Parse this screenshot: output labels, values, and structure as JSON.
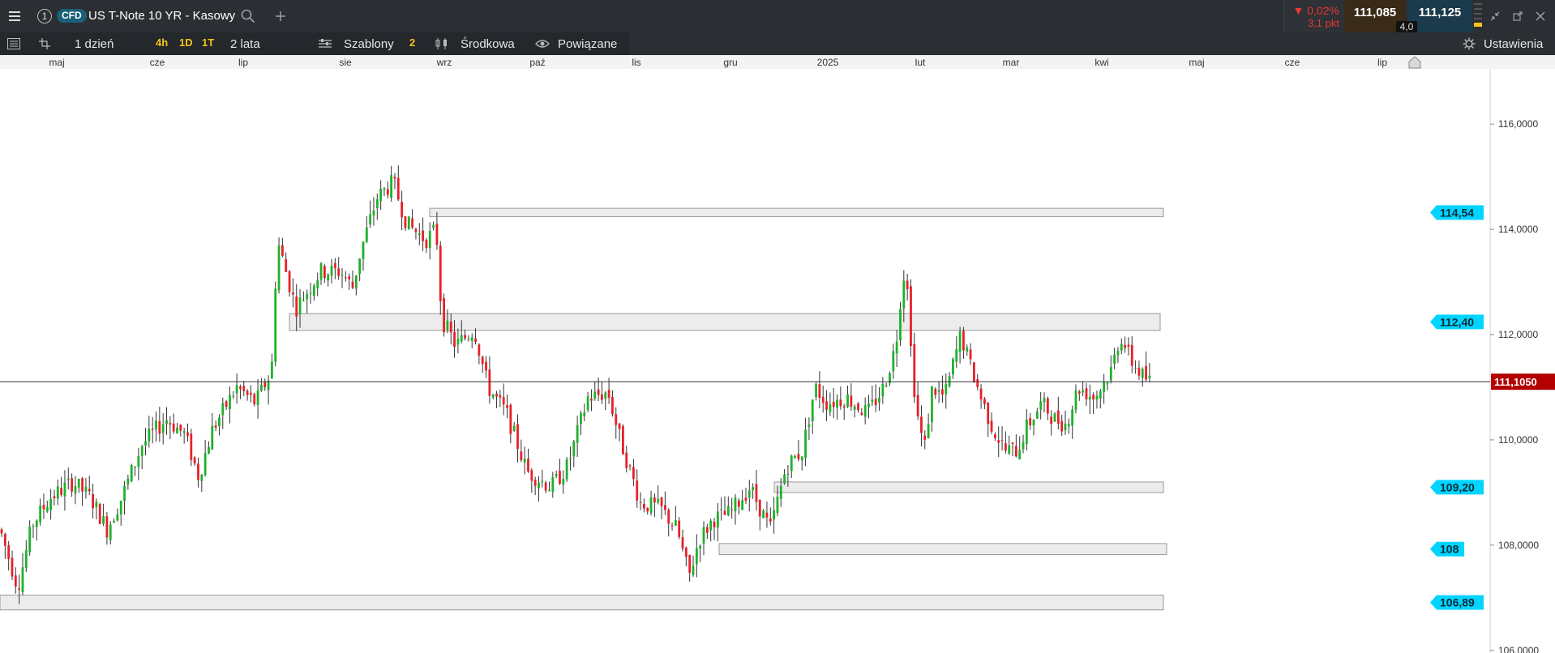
{
  "window": {
    "menu_icon": "hamburger-icon",
    "chart_number": "1",
    "instrument_badge": "CFD",
    "instrument_name": "US T-Note 10 YR - Kasowy",
    "search_icon": "search-icon",
    "add_icon": "plus-icon"
  },
  "quote": {
    "change_pct": "▼ 0,02%",
    "change_pts": "3,1 pkt",
    "sell": "111,085",
    "buy": "111,125",
    "spread": "4,0",
    "down_color": "#e53935",
    "sell_bg": "#3a2a18",
    "buy_bg": "#1b3a4b"
  },
  "window_controls": [
    "minimize-icon",
    "popout-icon",
    "close-icon"
  ],
  "toolbar": {
    "interval": "1 dzień",
    "quick_intervals": [
      "4h",
      "1D",
      "1T"
    ],
    "range": "2 lata",
    "templates": "Szablony",
    "indicator_count": "2",
    "price_type": "Środkowa",
    "linked": "Powiązane",
    "settings": "Ustawienia"
  },
  "chart_data": {
    "type": "candlestick",
    "title": "",
    "x_ticks": [
      "maj",
      "cze",
      "lip",
      "sie",
      "wrz",
      "paź",
      "lis",
      "gru",
      "2025",
      "lut",
      "mar",
      "kwi",
      "maj",
      "cze",
      "lip"
    ],
    "y_ticks": [
      "116,0000",
      "114,0000",
      "112,0000",
      "110,0000",
      "108,0000",
      "106,0000"
    ],
    "ylim": [
      105.95,
      117.05
    ],
    "up_color": "#1fb12b",
    "down_color": "#e8202a",
    "current_price": "111,1050",
    "current_price_value": 111.105,
    "zones": [
      {
        "label": "114,54",
        "from": 114.24,
        "to": 114.4
      },
      {
        "label": "112,40",
        "from": 112.08,
        "to": 112.4
      },
      {
        "label": "109,20",
        "from": 109.0,
        "to": 109.2
      },
      {
        "label": "108",
        "from": 107.82,
        "to": 108.03
      },
      {
        "label": "106,89",
        "from": 106.77,
        "to": 107.05
      }
    ],
    "anchors": [
      [
        0,
        108.3
      ],
      [
        22,
        107.2
      ],
      [
        40,
        108.4
      ],
      [
        62,
        108.9
      ],
      [
        90,
        109.2
      ],
      [
        112,
        108.9
      ],
      [
        132,
        108.3
      ],
      [
        150,
        108.9
      ],
      [
        175,
        109.9
      ],
      [
        205,
        110.4
      ],
      [
        228,
        110.1
      ],
      [
        245,
        109.3
      ],
      [
        262,
        110.2
      ],
      [
        292,
        111.0
      ],
      [
        315,
        110.7
      ],
      [
        335,
        111.3
      ],
      [
        342,
        113.8
      ],
      [
        365,
        112.5
      ],
      [
        395,
        113.2
      ],
      [
        420,
        113.2
      ],
      [
        435,
        112.9
      ],
      [
        445,
        113.6
      ],
      [
        465,
        114.6
      ],
      [
        485,
        114.9
      ],
      [
        502,
        114.1
      ],
      [
        525,
        113.8
      ],
      [
        538,
        114.0
      ],
      [
        545,
        112.3
      ],
      [
        562,
        111.8
      ],
      [
        585,
        112.1
      ],
      [
        602,
        111.0
      ],
      [
        625,
        110.5
      ],
      [
        650,
        109.4
      ],
      [
        680,
        109.1
      ],
      [
        700,
        109.5
      ],
      [
        725,
        110.8
      ],
      [
        750,
        110.9
      ],
      [
        765,
        110.0
      ],
      [
        790,
        108.8
      ],
      [
        815,
        108.7
      ],
      [
        835,
        108.3
      ],
      [
        850,
        107.4
      ],
      [
        862,
        108.1
      ],
      [
        880,
        108.5
      ],
      [
        900,
        108.6
      ],
      [
        925,
        109.1
      ],
      [
        950,
        108.3
      ],
      [
        970,
        109.5
      ],
      [
        990,
        109.8
      ],
      [
        1005,
        111.0
      ],
      [
        1020,
        110.7
      ],
      [
        1045,
        110.8
      ],
      [
        1070,
        110.5
      ],
      [
        1090,
        111.0
      ],
      [
        1105,
        111.8
      ],
      [
        1112,
        112.9
      ],
      [
        1118,
        113.4
      ],
      [
        1122,
        112.0
      ],
      [
        1130,
        110.6
      ],
      [
        1140,
        109.8
      ],
      [
        1150,
        111.0
      ],
      [
        1165,
        110.8
      ],
      [
        1185,
        112.0
      ],
      [
        1195,
        111.5
      ],
      [
        1210,
        110.8
      ],
      [
        1225,
        110.2
      ],
      [
        1240,
        109.8
      ],
      [
        1255,
        109.8
      ],
      [
        1265,
        110.2
      ],
      [
        1285,
        110.7
      ],
      [
        1300,
        110.4
      ],
      [
        1315,
        110.3
      ],
      [
        1330,
        111.0
      ],
      [
        1350,
        110.8
      ],
      [
        1370,
        111.3
      ],
      [
        1382,
        112.0
      ],
      [
        1395,
        111.5
      ],
      [
        1410,
        111.2
      ],
      [
        1420,
        111.1
      ]
    ]
  }
}
